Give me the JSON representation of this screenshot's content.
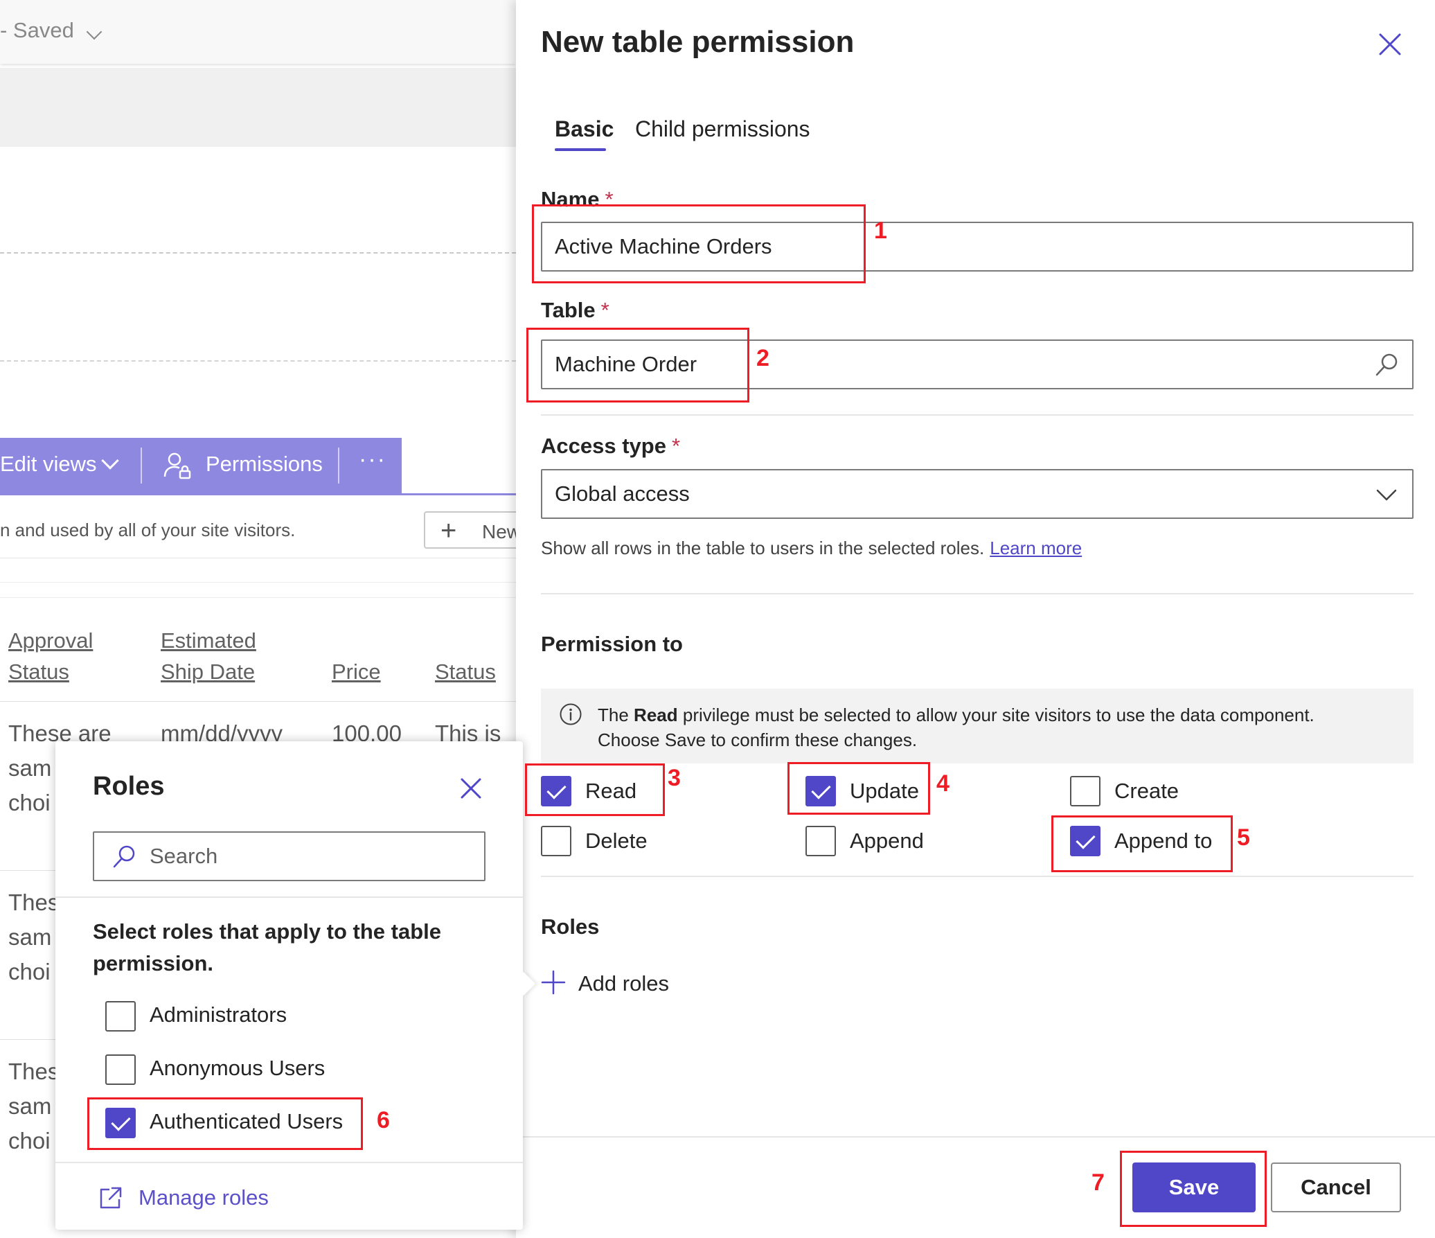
{
  "background_app": {
    "saved_status": "- Saved",
    "toolbar": {
      "edit_views_label": "Edit views",
      "permissions_label": "Permissions",
      "more_label": "···"
    },
    "description": "n and used by all of your site visitors.",
    "new_button_label": "New",
    "columns": [
      {
        "line1": "Approval",
        "line2": "Status"
      },
      {
        "line1": "Estimated",
        "line2": "Ship Date"
      },
      {
        "line1": "",
        "line2": "Price"
      },
      {
        "line1": "",
        "line2": "Status"
      }
    ],
    "row1": [
      "These are",
      "mm/dd/yyyy",
      "100.00",
      "This is"
    ],
    "row1_cont": [
      "sam",
      "choi"
    ],
    "row2": [
      "Thes",
      "sam",
      "choi"
    ],
    "row3": [
      "Thes",
      "sam",
      "choi"
    ]
  },
  "roles_flyout": {
    "title": "Roles",
    "search_placeholder": "Search",
    "instruction": "Select roles that apply to the table permission.",
    "options": [
      {
        "label": "Administrators",
        "checked": false
      },
      {
        "label": "Anonymous Users",
        "checked": false
      },
      {
        "label": "Authenticated Users",
        "checked": true
      }
    ],
    "manage_roles_label": "Manage roles"
  },
  "panel": {
    "title": "New table permission",
    "tabs": [
      {
        "label": "Basic",
        "active": true
      },
      {
        "label": "Child permissions",
        "active": false
      }
    ],
    "name_label": "Name",
    "name_value": "Active Machine Orders",
    "table_label": "Table",
    "table_value": "Machine Order",
    "access_type_label": "Access type",
    "access_type_value": "Global access",
    "required_marker": "*",
    "help_text": "Show all rows in the table to users in the selected roles.",
    "learn_more_label": "Learn more",
    "permission_to_label": "Permission to",
    "info_prefix": "The",
    "info_bold": "Read",
    "info_rest": "privilege must be selected to allow your site visitors to use the data component.",
    "info_line2": "Choose Save to confirm these changes.",
    "permissions": [
      {
        "label": "Read",
        "checked": true
      },
      {
        "label": "Update",
        "checked": true
      },
      {
        "label": "Create",
        "checked": false
      },
      {
        "label": "Delete",
        "checked": false
      },
      {
        "label": "Append",
        "checked": false
      },
      {
        "label": "Append to",
        "checked": true
      }
    ],
    "roles_label": "Roles",
    "add_roles_label": "Add roles",
    "save_label": "Save",
    "cancel_label": "Cancel"
  },
  "annotations": [
    "1",
    "2",
    "3",
    "4",
    "5",
    "6",
    "7"
  ],
  "colors": {
    "accent": "#4f46c8",
    "command_bar": "#8f88e0",
    "annotation": "#ee1c25",
    "required": "#c4314b"
  }
}
